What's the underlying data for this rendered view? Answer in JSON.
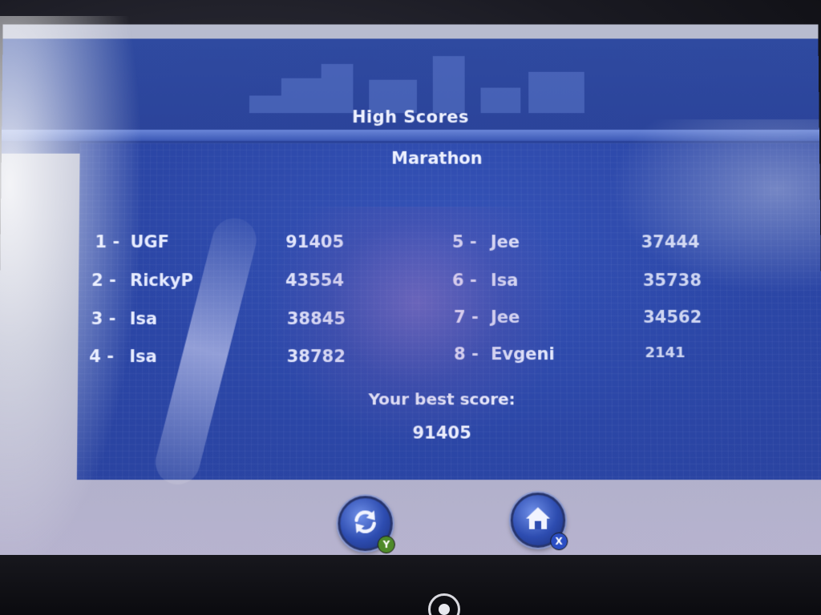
{
  "screen": {
    "title": "High Scores",
    "mode": "Marathon"
  },
  "scores_left": [
    {
      "rank": "1 -",
      "name": "UGF",
      "score": "91405"
    },
    {
      "rank": "2 -",
      "name": "RickyP",
      "score": "43554"
    },
    {
      "rank": "3 -",
      "name": "Isa",
      "score": "38845"
    },
    {
      "rank": "4 -",
      "name": "Isa",
      "score": "38782"
    }
  ],
  "scores_right": [
    {
      "rank": "5 -",
      "name": "Jee",
      "score": "37444"
    },
    {
      "rank": "6 -",
      "name": "Isa",
      "score": "35738"
    },
    {
      "rank": "7 -",
      "name": "Jee",
      "score": "34562"
    },
    {
      "rank": "8 -",
      "name": "Evgeni",
      "score": "2141"
    }
  ],
  "best": {
    "label": "Your best score:",
    "value": "91405"
  },
  "buttons": {
    "restart_icon": "refresh-icon",
    "restart_badge": "Y",
    "home_icon": "home-icon",
    "home_badge": "X"
  },
  "colors": {
    "panel": "#2b46a6",
    "text": "#eef1ff",
    "badge_y": "#4e8a2a",
    "badge_x": "#2b4ec4"
  }
}
